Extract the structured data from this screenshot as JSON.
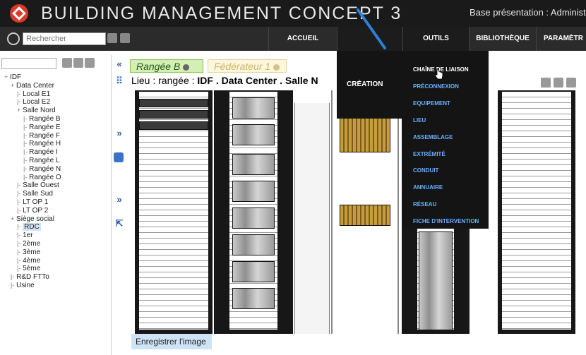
{
  "app": {
    "title": "BUILDING MANAGEMENT CONCEPT 3",
    "base_label": "Base présentation : Administr"
  },
  "nav": {
    "search_placeholder": "Rechercher",
    "items": [
      "ACCUEIL",
      "OUTILS",
      "BIBLIOTHÈQUE",
      "PARAMÈTR"
    ]
  },
  "menu": {
    "creation": "CRÉATION",
    "items": [
      "CHAÎNE DE LIAISON",
      "PRÉCONNEXION",
      "EQUIPEMENT",
      "LIEU",
      "ASSEMBLAGE",
      "EXTRÉMITÉ",
      "CONDUIT",
      "ANNUAIRE",
      "RÉSEAU",
      "FICHE D'INTERVENTION"
    ]
  },
  "tabs": [
    "Rangée B",
    "Fédérateur 1"
  ],
  "lieu": {
    "prefix": "Lieu :  rangée :",
    "path": "IDF . Data Center . Salle N"
  },
  "tree": [
    {
      "mk": "+",
      "label": "IDF",
      "indent": 0
    },
    {
      "mk": "+",
      "label": "Data Center",
      "indent": 1
    },
    {
      "mk": "|-",
      "label": "Local E1",
      "indent": 2
    },
    {
      "mk": "|-",
      "label": "Local E2",
      "indent": 2
    },
    {
      "mk": "+",
      "label": "Salle Nord",
      "indent": 2
    },
    {
      "mk": "|-",
      "label": "Rangée B",
      "indent": 3
    },
    {
      "mk": "|-",
      "label": "Rangée E",
      "indent": 3
    },
    {
      "mk": "|-",
      "label": "Rangée F",
      "indent": 3
    },
    {
      "mk": "|-",
      "label": "Rangée H",
      "indent": 3
    },
    {
      "mk": "|-",
      "label": "Rangée I",
      "indent": 3
    },
    {
      "mk": "|-",
      "label": "Rangée L",
      "indent": 3
    },
    {
      "mk": "|-",
      "label": "Rangée N",
      "indent": 3
    },
    {
      "mk": "|-",
      "label": "Rangée O",
      "indent": 3
    },
    {
      "mk": "|-",
      "label": "Salle Ouest",
      "indent": 2
    },
    {
      "mk": "|-",
      "label": "Salle Sud",
      "indent": 2
    },
    {
      "mk": "|-",
      "label": "LT OP 1",
      "indent": 2
    },
    {
      "mk": "|-",
      "label": "LT OP 2",
      "indent": 2
    },
    {
      "mk": "+",
      "label": "Siège social",
      "indent": 1
    },
    {
      "mk": "|-",
      "label": "RDC",
      "indent": 2,
      "selected": true
    },
    {
      "mk": "|-",
      "label": "1er",
      "indent": 2
    },
    {
      "mk": "|-",
      "label": "2ème",
      "indent": 2
    },
    {
      "mk": "|-",
      "label": "3ème",
      "indent": 2
    },
    {
      "mk": "|-",
      "label": "4ème",
      "indent": 2
    },
    {
      "mk": "|-",
      "label": "5ème",
      "indent": 2
    },
    {
      "mk": "|-",
      "label": "R&D FTTo",
      "indent": 1
    },
    {
      "mk": "|-",
      "label": "Usine",
      "indent": 1
    }
  ],
  "save_image_label": "Enregistrer l'image",
  "colors": {
    "titlebar": "#1a1a1a",
    "navbar": "#2b2b2b",
    "menu_link": "#6ab0ff",
    "tab_active": "#d3efb6",
    "tab_inactive": "#fbf6dc",
    "logo": "#d93a2b"
  }
}
